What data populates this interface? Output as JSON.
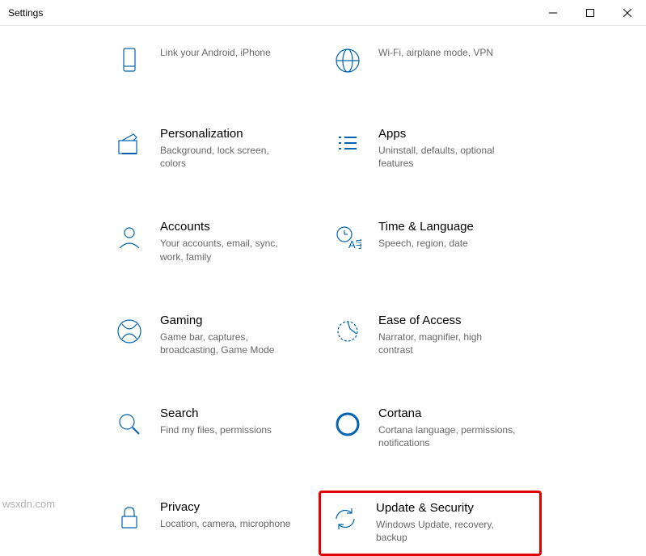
{
  "window": {
    "title": "Settings",
    "watermark": "wsxdn.com"
  },
  "items": [
    {
      "title": "",
      "desc": "Link your Android, iPhone"
    },
    {
      "title": "",
      "desc": "Wi-Fi, airplane mode, VPN"
    },
    {
      "title": "Personalization",
      "desc": "Background, lock screen, colors"
    },
    {
      "title": "Apps",
      "desc": "Uninstall, defaults, optional features"
    },
    {
      "title": "Accounts",
      "desc": "Your accounts, email, sync, work, family"
    },
    {
      "title": "Time & Language",
      "desc": "Speech, region, date"
    },
    {
      "title": "Gaming",
      "desc": "Game bar, captures, broadcasting, Game Mode"
    },
    {
      "title": "Ease of Access",
      "desc": "Narrator, magnifier, high contrast"
    },
    {
      "title": "Search",
      "desc": "Find my files, permissions"
    },
    {
      "title": "Cortana",
      "desc": "Cortana language, permissions, notifications"
    },
    {
      "title": "Privacy",
      "desc": "Location, camera, microphone"
    },
    {
      "title": "Update & Security",
      "desc": "Windows Update, recovery, backup"
    }
  ]
}
